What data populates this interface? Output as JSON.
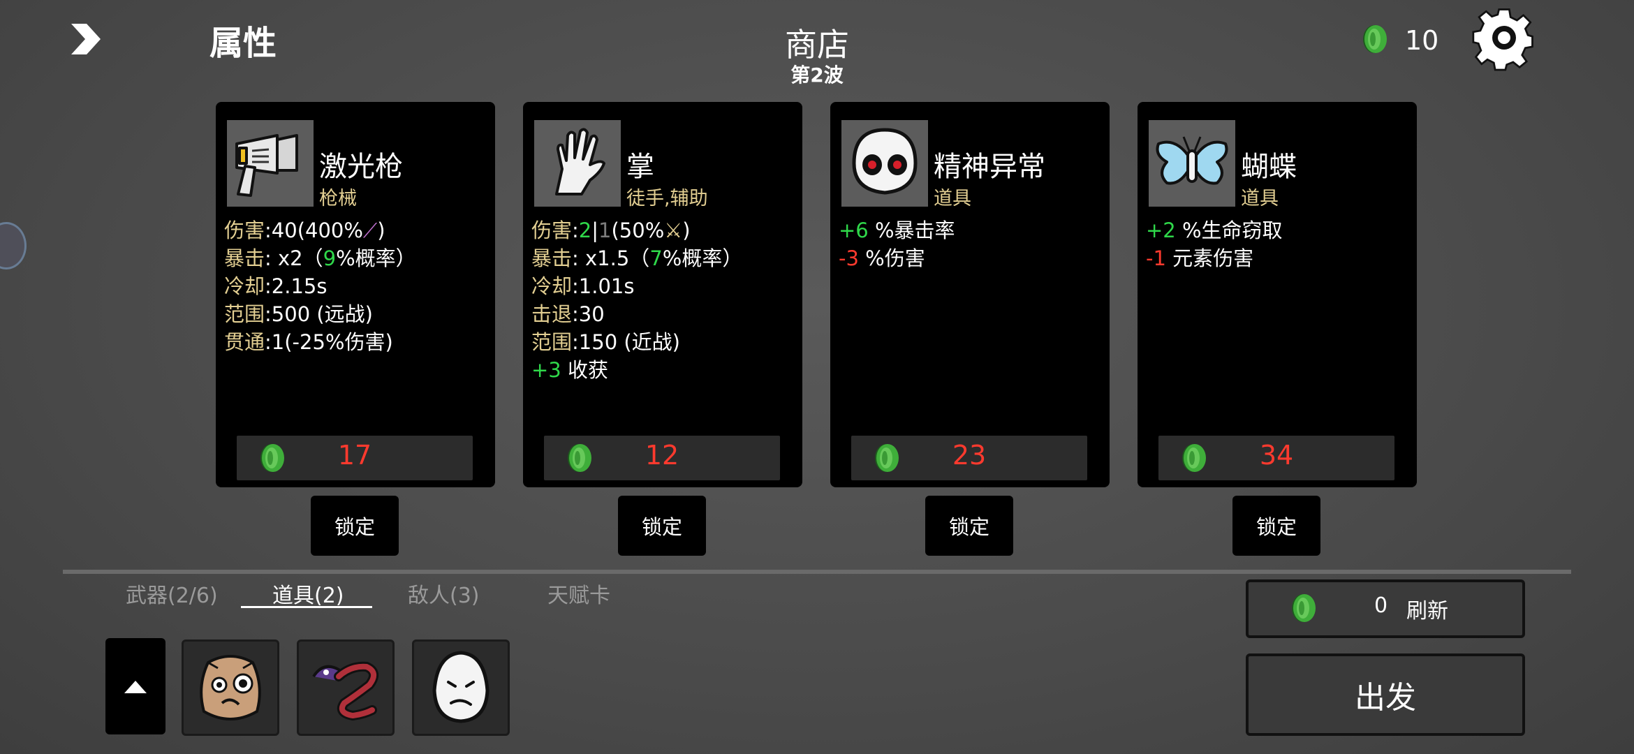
{
  "header": {
    "attributes_title": "属性",
    "shop_title": "商店",
    "wave_label": "第2波",
    "gold_amount": "10"
  },
  "colors": {
    "positive": "#2fd84a",
    "negative": "#ff3a2e",
    "label": "#e3cf92",
    "card_bg": "#000000"
  },
  "cards": [
    {
      "name": "激光枪",
      "type": "枪械",
      "icon": "laser-gun-icon",
      "stats": {
        "damage_label": "伤害",
        "damage_value": "40(400%",
        "crit_label": "暴击",
        "crit_value_pre": " x2（",
        "crit_chance": "9",
        "crit_value_post": "%概率）",
        "cooldown_label": "冷却",
        "cooldown_value": "2.15s",
        "range_label": "范围",
        "range_value": "500 (远战)",
        "pierce_label": "贯通",
        "pierce_value": "1(-25%伤害)"
      },
      "price": "17",
      "lock_label": "锁定"
    },
    {
      "name": "掌",
      "type": "徒手,辅助",
      "icon": "palm-icon",
      "stats": {
        "damage_label": "伤害",
        "damage_current": "2",
        "damage_sep": "|",
        "damage_base": "1",
        "damage_tail": "(50%",
        "crit_label": "暴击",
        "crit_value_pre": " x1.5（",
        "crit_chance": "7",
        "crit_value_post": "%概率）",
        "cooldown_label": "冷却",
        "cooldown_value": "1.01s",
        "knockback_label": "击退",
        "knockback_value": "30",
        "range_label": "范围",
        "range_value": "150 (近战)",
        "bonus_value": "+3",
        "bonus_label": "收获"
      },
      "price": "12",
      "lock_label": "锁定"
    },
    {
      "name": "精神异常",
      "type": "道具",
      "icon": "mental-anomaly-icon",
      "effects": [
        {
          "value": "+6",
          "label": "%暴击率",
          "positive": true
        },
        {
          "value": "-3",
          "label": "%伤害",
          "positive": false
        }
      ],
      "price": "23",
      "lock_label": "锁定"
    },
    {
      "name": "蝴蝶",
      "type": "道具",
      "icon": "butterfly-icon",
      "effects": [
        {
          "value": "+2",
          "label": "%生命窃取",
          "positive": true
        },
        {
          "value": "-1",
          "label": "元素伤害",
          "positive": false
        }
      ],
      "price": "34",
      "lock_label": "锁定"
    }
  ],
  "tabs": [
    {
      "label": "武器(2/6)",
      "active": false
    },
    {
      "label": "道具(2)",
      "active": true
    },
    {
      "label": "敌人(3)",
      "active": false
    },
    {
      "label": "天赋卡",
      "active": false
    }
  ],
  "inventory": [
    {
      "icon": "sack-face-icon"
    },
    {
      "icon": "tongue-worm-icon"
    },
    {
      "icon": "sad-egg-icon"
    }
  ],
  "refresh": {
    "cost": "0",
    "label": "刷新"
  },
  "go_label": "出发"
}
